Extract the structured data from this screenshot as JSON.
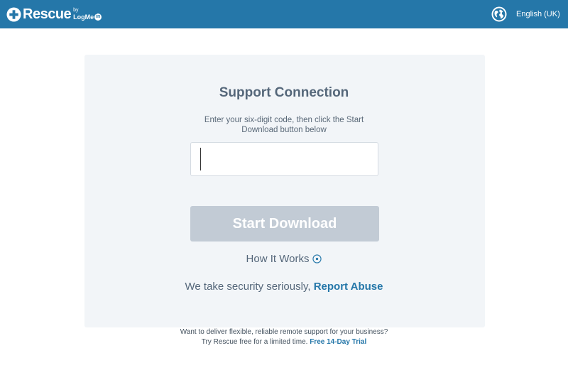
{
  "header": {
    "logo": {
      "name": "Rescue",
      "by": "by",
      "brand": "LogMe",
      "brand_badge": "in"
    },
    "globe_icon": "globe-icon",
    "language": "English (UK)"
  },
  "main": {
    "title": "Support Connection",
    "instructions": "Enter your six-digit code, then click the Start Download button below",
    "code_input": {
      "value": "",
      "placeholder": ""
    },
    "start_button_label": "Start Download",
    "how_it_works_label": "How It Works",
    "how_it_works_icon": "chevron-down-circle-icon",
    "security_text": "We take security seriously,",
    "report_abuse_label": "Report Abuse"
  },
  "footer": {
    "line1": "Want to deliver flexible, reliable remote support for your business?",
    "line2": "Try Rescue free for a limited time.",
    "trial_label": "Free 14-Day Trial"
  },
  "colors": {
    "header_bg": "#2577a9",
    "card_bg": "#f2f5f8",
    "button_disabled": "#c2cbd5",
    "link": "#2577a9",
    "text": "#55677a"
  }
}
